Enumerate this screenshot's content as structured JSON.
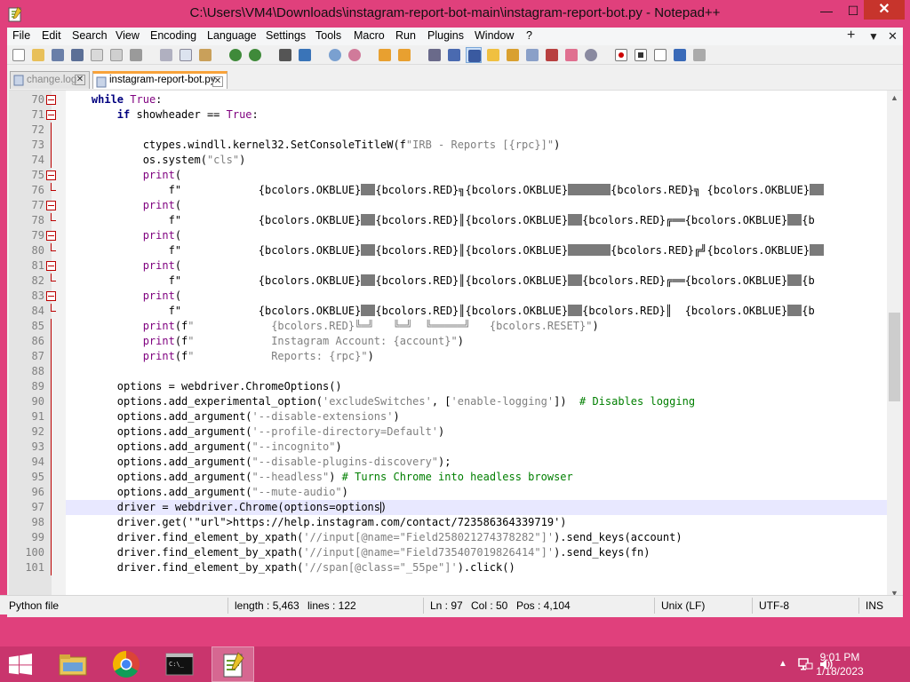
{
  "window": {
    "title": "C:\\Users\\VM4\\Downloads\\instagram-report-bot-main\\instagram-report-bot.py - Notepad++",
    "minimize": "—",
    "maximize": "☐",
    "close": "✕"
  },
  "menu": {
    "items": [
      "File",
      "Edit",
      "Search",
      "View",
      "Encoding",
      "Language",
      "Settings",
      "Tools",
      "Macro",
      "Run",
      "Plugins",
      "Window",
      "?"
    ],
    "plus": "+",
    "dropdown": "▼",
    "close": "✕"
  },
  "tabs": [
    {
      "label": "change.log",
      "active": false
    },
    {
      "label": "instagram-report-bot.py",
      "active": true
    }
  ],
  "code": {
    "lines": [
      {
        "n": "70",
        "text": "    while True:"
      },
      {
        "n": "71",
        "text": "        if showheader == True:"
      },
      {
        "n": "72",
        "text": ""
      },
      {
        "n": "73",
        "text": "            ctypes.windll.kernel32.SetConsoleTitleW(f\"IRB - Reports [{rpc}]\")"
      },
      {
        "n": "74",
        "text": "            os.system(\"cls\")"
      },
      {
        "n": "75",
        "text": "            print("
      },
      {
        "n": "76",
        "text": "                f\"            {bcolors.OKBLUE}██{bcolors.RED}╗{bcolors.OKBLUE}██████{bcolors.RED}╗ {bcolors.OKBLUE}█"
      },
      {
        "n": "77",
        "text": "            print("
      },
      {
        "n": "78",
        "text": "                f\"            {bcolors.OKBLUE}██{bcolors.RED}║{bcolors.OKBLUE}██{bcolors.RED}╔══{bcolors.OKBLUE}██{b"
      },
      {
        "n": "79",
        "text": "            print("
      },
      {
        "n": "80",
        "text": "                f\"            {bcolors.OKBLUE}██{bcolors.RED}║{bcolors.OKBLUE}██████{bcolors.RED}╔╝{bcolors.OKBLUE}█"
      },
      {
        "n": "81",
        "text": "            print("
      },
      {
        "n": "82",
        "text": "                f\"            {bcolors.OKBLUE}██{bcolors.RED}║{bcolors.OKBLUE}██{bcolors.RED}╔══{bcolors.OKBLUE}██{b"
      },
      {
        "n": "83",
        "text": "            print("
      },
      {
        "n": "84",
        "text": "                f\"            {bcolors.OKBLUE}██{bcolors.RED}║{bcolors.OKBLUE}██{bcolors.RED}║  {bcolors.OKBLUE}██{b"
      },
      {
        "n": "85",
        "text": "            print(f\"            {bcolors.RED}╚═╝   ╚═╝  ╚═════╝   {bcolors.RESET}\")"
      },
      {
        "n": "86",
        "text": "            print(f\"            Instagram Account: {account}\")"
      },
      {
        "n": "87",
        "text": "            print(f\"            Reports: {rpc}\")"
      },
      {
        "n": "88",
        "text": ""
      },
      {
        "n": "89",
        "text": "        options = webdriver.ChromeOptions()"
      },
      {
        "n": "90",
        "text": "        options.add_experimental_option('excludeSwitches', ['enable-logging'])  # Disables logging"
      },
      {
        "n": "91",
        "text": "        options.add_argument('--disable-extensions')"
      },
      {
        "n": "92",
        "text": "        options.add_argument('--profile-directory=Default')"
      },
      {
        "n": "93",
        "text": "        options.add_argument(\"--incognito\")"
      },
      {
        "n": "94",
        "text": "        options.add_argument(\"--disable-plugins-discovery\");"
      },
      {
        "n": "95",
        "text": "        options.add_argument(\"--headless\") # Turns Chrome into headless browser"
      },
      {
        "n": "96",
        "text": "        options.add_argument(\"--mute-audio\")"
      },
      {
        "n": "97",
        "text": "        driver = webdriver.Chrome(options=options)"
      },
      {
        "n": "98",
        "text": "        driver.get('https://help.instagram.com/contact/723586364339719')"
      },
      {
        "n": "99",
        "text": "        driver.find_element_by_xpath('//input[@name=\"Field258021274378282\"]').send_keys(account)"
      },
      {
        "n": "100",
        "text": "        driver.find_element_by_xpath('//input[@name=\"Field735407019826414\"]').send_keys(fn)"
      },
      {
        "n": "101",
        "text": "        driver.find_element_by_xpath('//span[@class=\"_55pe\"]').click()"
      }
    ]
  },
  "status": {
    "filetype": "Python file",
    "length": "length : 5,463",
    "lines": "lines : 122",
    "ln": "Ln : 97",
    "col": "Col : 50",
    "pos": "Pos : 4,104",
    "eol": "Unix (LF)",
    "encoding": "UTF-8",
    "mode": "INS"
  },
  "taskbar": {
    "time": "9:01 PM",
    "date": "1/18/2023",
    "tray_chevron": "▲"
  },
  "colors": {
    "accent": "#e0407c",
    "taskbar": "#c9356d",
    "close": "#c7342c",
    "keyword": "#00007f",
    "comment": "#007f00",
    "string": "#7f7f7f"
  }
}
